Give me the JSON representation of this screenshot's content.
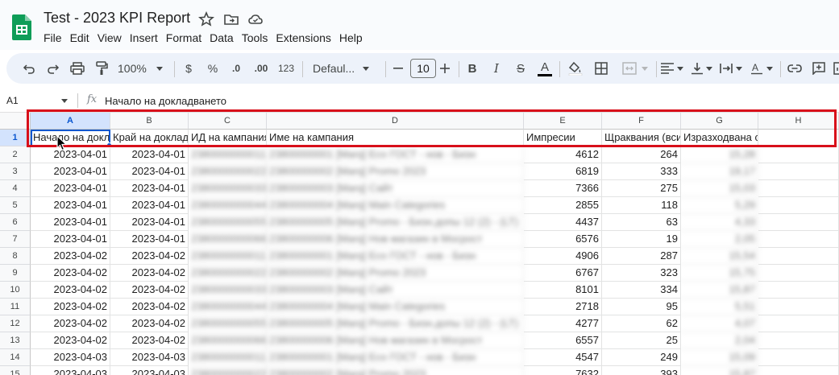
{
  "app": {
    "doc_title": "Test - 2023 KPI Report",
    "menu": [
      "File",
      "Edit",
      "View",
      "Insert",
      "Format",
      "Data",
      "Tools",
      "Extensions",
      "Help"
    ]
  },
  "toolbar": {
    "zoom": "100%",
    "currency": "$",
    "percent": "%",
    "dec_decrease": ".0",
    "dec_increase": ".00",
    "number_format": "123",
    "font": "Defaul...",
    "font_size": "10",
    "bold": "B",
    "italic": "I",
    "strike": "S",
    "text_color": "A"
  },
  "formula_bar": {
    "cell_ref": "A1",
    "fx": "fx",
    "value": "Начало на докладването"
  },
  "sheet": {
    "columns": [
      "A",
      "B",
      "C",
      "D",
      "E",
      "F",
      "G",
      "H"
    ],
    "header_row": [
      "Начало на докл",
      "Край на доклад",
      "ИД на кампания",
      "Име на кампания",
      "Импресии",
      "Щраквания (вси",
      "Изразходвана сума (EUR)",
      ""
    ],
    "rows": [
      {
        "n": "2",
        "a": "2023-04-01",
        "b": "2023-04-01",
        "c": "2380000000011",
        "d": "23800000001 [Marq] Eco ГОСТ - нов - Бизн",
        "e": "4612",
        "f": "264",
        "g": "15,28"
      },
      {
        "n": "3",
        "a": "2023-04-01",
        "b": "2023-04-01",
        "c": "2380000000022",
        "d": "23800000002 [Marq] Promo 2023",
        "e": "6819",
        "f": "333",
        "g": "19,17"
      },
      {
        "n": "4",
        "a": "2023-04-01",
        "b": "2023-04-01",
        "c": "2380000000033",
        "d": "23800000003 [Marq] Сайт",
        "e": "7366",
        "f": "275",
        "g": "15,03"
      },
      {
        "n": "5",
        "a": "2023-04-01",
        "b": "2023-04-01",
        "c": "2380000000044",
        "d": "23800000004 [Marq] Main Categories",
        "e": "2855",
        "f": "118",
        "g": "5,29"
      },
      {
        "n": "6",
        "a": "2023-04-01",
        "b": "2023-04-01",
        "c": "2380000000055",
        "d": "23800000005 [Marq] Promo - Бизн.допы 12 (2) - (LT)",
        "e": "4437",
        "f": "63",
        "g": "4,33"
      },
      {
        "n": "7",
        "a": "2023-04-01",
        "b": "2023-04-01",
        "c": "2380000000066",
        "d": "23800000006 [Marq] Нов магазин в Мосрост",
        "e": "6576",
        "f": "19",
        "g": "2,05"
      },
      {
        "n": "8",
        "a": "2023-04-02",
        "b": "2023-04-02",
        "c": "2380000000011",
        "d": "23800000001 [Marq] Eco ГОСТ - нов - Бизн",
        "e": "4906",
        "f": "287",
        "g": "15,54"
      },
      {
        "n": "9",
        "a": "2023-04-02",
        "b": "2023-04-02",
        "c": "2380000000022",
        "d": "23800000002 [Marq] Promo 2023",
        "e": "6767",
        "f": "323",
        "g": "15,75"
      },
      {
        "n": "10",
        "a": "2023-04-02",
        "b": "2023-04-02",
        "c": "2380000000033",
        "d": "23800000003 [Marq] Сайт",
        "e": "8101",
        "f": "334",
        "g": "15,87"
      },
      {
        "n": "11",
        "a": "2023-04-02",
        "b": "2023-04-02",
        "c": "2380000000044",
        "d": "23800000004 [Marq] Main Categories",
        "e": "2718",
        "f": "95",
        "g": "5,51"
      },
      {
        "n": "12",
        "a": "2023-04-02",
        "b": "2023-04-02",
        "c": "2380000000055",
        "d": "23800000005 [Marq] Promo - Бизн.допы 12 (2) - (LT)",
        "e": "4277",
        "f": "62",
        "g": "4,07"
      },
      {
        "n": "13",
        "a": "2023-04-02",
        "b": "2023-04-02",
        "c": "2380000000066",
        "d": "23800000006 [Marq] Нов магазин в Мосрост",
        "e": "6557",
        "f": "25",
        "g": "2,04"
      },
      {
        "n": "14",
        "a": "2023-04-03",
        "b": "2023-04-03",
        "c": "2380000000011",
        "d": "23800000001 [Marq] Eco ГОСТ - нов - Бизн",
        "e": "4547",
        "f": "249",
        "g": "15,09"
      },
      {
        "n": "15",
        "a": "2023-04-03",
        "b": "2023-04-03",
        "c": "2380000000022",
        "d": "23800000002 [Marq] Promo 2023",
        "e": "7632",
        "f": "393",
        "g": "15,87"
      }
    ]
  },
  "colors": {
    "accent": "#0b57d0",
    "highlight_box": "#d80f1a",
    "sheets_green": "#0f9d58"
  }
}
